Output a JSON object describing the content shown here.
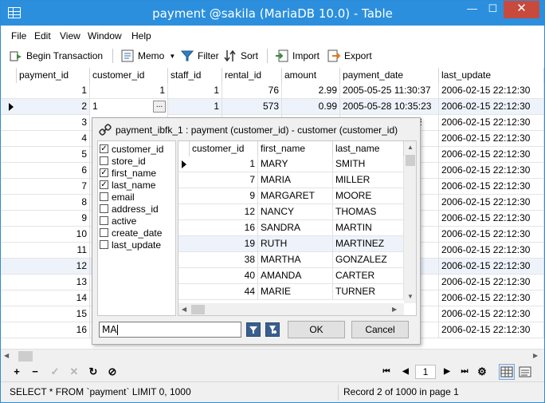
{
  "window": {
    "title": "payment @sakila (MariaDB 10.0) - Table",
    "min_glyph": "—",
    "max_glyph": "☐",
    "close_glyph": "✕"
  },
  "menu": [
    "File",
    "Edit",
    "View",
    "Window",
    "Help"
  ],
  "toolbar": {
    "begin_transaction": "Begin Transaction",
    "memo": "Memo",
    "filter": "Filter",
    "sort": "Sort",
    "import": "Import",
    "export": "Export"
  },
  "grid": {
    "columns": [
      "payment_id",
      "customer_id",
      "staff_id",
      "rental_id",
      "amount",
      "payment_date",
      "last_update"
    ],
    "rows": [
      {
        "payment_id": "1",
        "customer_id": "1",
        "staff_id": "1",
        "rental_id": "76",
        "amount": "2.99",
        "payment_date": "2005-05-25 11:30:37",
        "last_update": "2006-02-15 22:12:30"
      },
      {
        "payment_id": "2",
        "customer_id": "1",
        "staff_id": "1",
        "rental_id": "573",
        "amount": "0.99",
        "payment_date": "2005-05-28 10:35:23",
        "last_update": "2006-02-15 22:12:30"
      },
      {
        "payment_id": "3",
        "last_update": "2006-02-15 22:12:30"
      },
      {
        "payment_id": "4",
        "last_update": "2006-02-15 22:12:30"
      },
      {
        "payment_id": "5",
        "last_update": "2006-02-15 22:12:30"
      },
      {
        "payment_id": "6",
        "last_update": "2006-02-15 22:12:30"
      },
      {
        "payment_id": "7",
        "last_update": "2006-02-15 22:12:30"
      },
      {
        "payment_id": "8",
        "last_update": "2006-02-15 22:12:30"
      },
      {
        "payment_id": "9",
        "last_update": "2006-02-15 22:12:30"
      },
      {
        "payment_id": "10",
        "last_update": "2006-02-15 22:12:30"
      },
      {
        "payment_id": "11",
        "last_update": "2006-02-15 22:12:30"
      },
      {
        "payment_id": "12",
        "last_update": "2006-02-15 22:12:30"
      },
      {
        "payment_id": "13",
        "last_update": "2006-02-15 22:12:30"
      },
      {
        "payment_id": "14",
        "last_update": "2006-02-15 22:12:30"
      },
      {
        "payment_id": "15",
        "last_update": "2006-02-15 22:12:30"
      },
      {
        "payment_id": "16",
        "last_update": "2006-02-15 22:12:30"
      }
    ],
    "partial_payment_date_tail": "2"
  },
  "lookup_popup": {
    "title": "payment_ibfk_1 : payment (customer_id) - customer (customer_id)",
    "fields": [
      {
        "name": "customer_id",
        "checked": true
      },
      {
        "name": "store_id",
        "checked": false
      },
      {
        "name": "first_name",
        "checked": true
      },
      {
        "name": "last_name",
        "checked": true
      },
      {
        "name": "email",
        "checked": false
      },
      {
        "name": "address_id",
        "checked": false
      },
      {
        "name": "active",
        "checked": false
      },
      {
        "name": "create_date",
        "checked": false
      },
      {
        "name": "last_update",
        "checked": false
      }
    ],
    "columns": [
      "customer_id",
      "first_name",
      "last_name"
    ],
    "rows": [
      {
        "customer_id": "1",
        "first_name": "MARY",
        "last_name": "SMITH"
      },
      {
        "customer_id": "7",
        "first_name": "MARIA",
        "last_name": "MILLER"
      },
      {
        "customer_id": "9",
        "first_name": "MARGARET",
        "last_name": "MOORE"
      },
      {
        "customer_id": "12",
        "first_name": "NANCY",
        "last_name": "THOMAS"
      },
      {
        "customer_id": "16",
        "first_name": "SANDRA",
        "last_name": "MARTIN"
      },
      {
        "customer_id": "19",
        "first_name": "RUTH",
        "last_name": "MARTINEZ"
      },
      {
        "customer_id": "38",
        "first_name": "MARTHA",
        "last_name": "GONZALEZ"
      },
      {
        "customer_id": "40",
        "first_name": "AMANDA",
        "last_name": "CARTER"
      },
      {
        "customer_id": "44",
        "first_name": "MARIE",
        "last_name": "TURNER"
      }
    ],
    "search_value": "MA",
    "ok": "OK",
    "cancel": "Cancel"
  },
  "nav": {
    "page": "1",
    "add": "+",
    "remove": "−",
    "apply": "✓",
    "discard": "✕",
    "refresh": "↻",
    "stop": "⊘",
    "first": "⏮",
    "prev": "◀",
    "next": "▶",
    "last": "⏭",
    "settings": "⚙"
  },
  "status": {
    "sql": "SELECT * FROM `payment` LIMIT 0, 1000",
    "record": "Record 2 of 1000 in page 1"
  },
  "colors": {
    "titlebar": "#2b8fdd",
    "close": "#c74a3d",
    "selected_row": "#eef3fb"
  }
}
